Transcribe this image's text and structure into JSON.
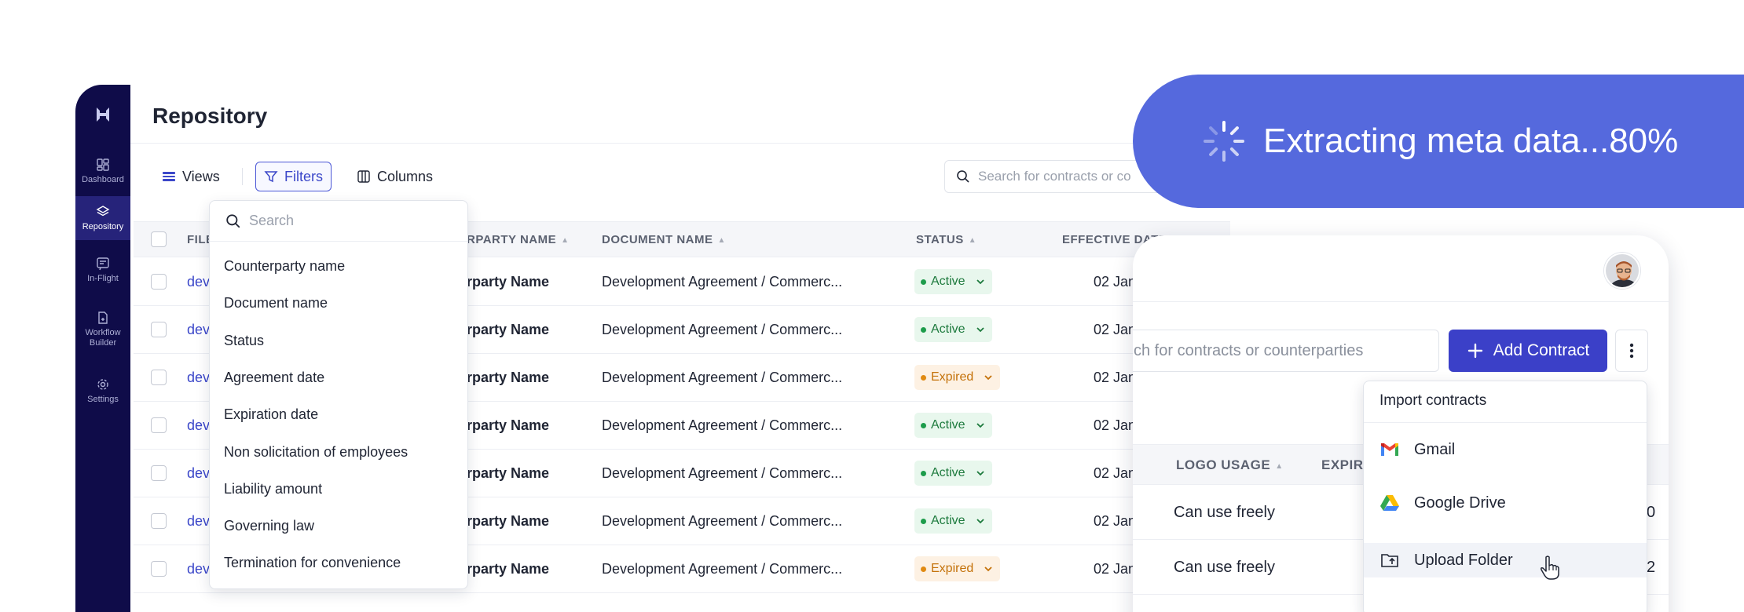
{
  "sidebar": {
    "items": [
      {
        "label": "Dashboard",
        "icon": "dashboard-icon"
      },
      {
        "label": "Repository",
        "icon": "layers-icon",
        "active": true
      },
      {
        "label": "In-Flight",
        "icon": "inflight-icon"
      },
      {
        "label": "Workflow Builder",
        "icon": "workflow-icon"
      },
      {
        "label": "Settings",
        "icon": "gear-icon"
      }
    ]
  },
  "page": {
    "title": "Repository"
  },
  "toolbar": {
    "views_label": "Views",
    "filters_label": "Filters",
    "columns_label": "Columns",
    "search_placeholder": "Search for contracts or co"
  },
  "table": {
    "headers": {
      "file": "FILE",
      "counterparty": "RPARTY NAME",
      "document": "DOCUMENT NAME",
      "status": "STATUS",
      "effective": "EFFECTIVE DATE"
    },
    "rows": [
      {
        "file": "dev",
        "counterparty": "rparty Name",
        "document": "Development Agreement / Commerc...",
        "status": "Active",
        "date": "02 Jan"
      },
      {
        "file": "dev",
        "counterparty": "rparty Name",
        "document": "Development Agreement / Commerc...",
        "status": "Active",
        "date": "02 Jan"
      },
      {
        "file": "dev",
        "counterparty": "rparty Name",
        "document": "Development Agreement / Commerc...",
        "status": "Expired",
        "date": "02 Jan"
      },
      {
        "file": "dev",
        "counterparty": "rparty Name",
        "document": "Development Agreement / Commerc...",
        "status": "Active",
        "date": "02 Jan"
      },
      {
        "file": "dev",
        "counterparty": "rparty Name",
        "document": "Development Agreement / Commerc...",
        "status": "Active",
        "date": "02 Jan"
      },
      {
        "file": "dev",
        "counterparty": "rparty Name",
        "document": "Development Agreement / Commerc...",
        "status": "Active",
        "date": "02 Jan"
      },
      {
        "file": "dev",
        "counterparty": "rparty Name",
        "document": "Development Agreement / Commerc...",
        "status": "Expired",
        "date": "02 Jan"
      }
    ]
  },
  "filter_dropdown": {
    "search_placeholder": "Search",
    "options": [
      "Counterparty name",
      "Document name",
      "Status",
      "Agreement date",
      "Expiration date",
      "Non solicitation of employees",
      "Liability amount",
      "Governing law",
      "Termination for convenience"
    ]
  },
  "banner": {
    "text": "Extracting meta data...80%",
    "progress": 80
  },
  "card": {
    "search_placeholder": "ch for contracts or counterparties",
    "add_contract_label": "Add Contract",
    "headers": {
      "logo_usage": "LOGO USAGE",
      "expiry": "EXPIR"
    },
    "rows": [
      {
        "logo_usage": "Can use freely",
        "edge": "0"
      },
      {
        "logo_usage": "Can use freely",
        "edge": "2"
      }
    ]
  },
  "import_dropdown": {
    "title": "Import contracts",
    "items": [
      {
        "label": "Gmail",
        "icon": "gmail-icon"
      },
      {
        "label": "Google Drive",
        "icon": "google-drive-icon"
      },
      {
        "label": "Upload Folder",
        "icon": "upload-folder-icon"
      }
    ]
  },
  "colors": {
    "sidebar": "#0f0c49",
    "accent": "#3b40c8",
    "banner": "#5569dd",
    "active_badge": "#1d7a3d",
    "expired_badge": "#c4720a"
  }
}
